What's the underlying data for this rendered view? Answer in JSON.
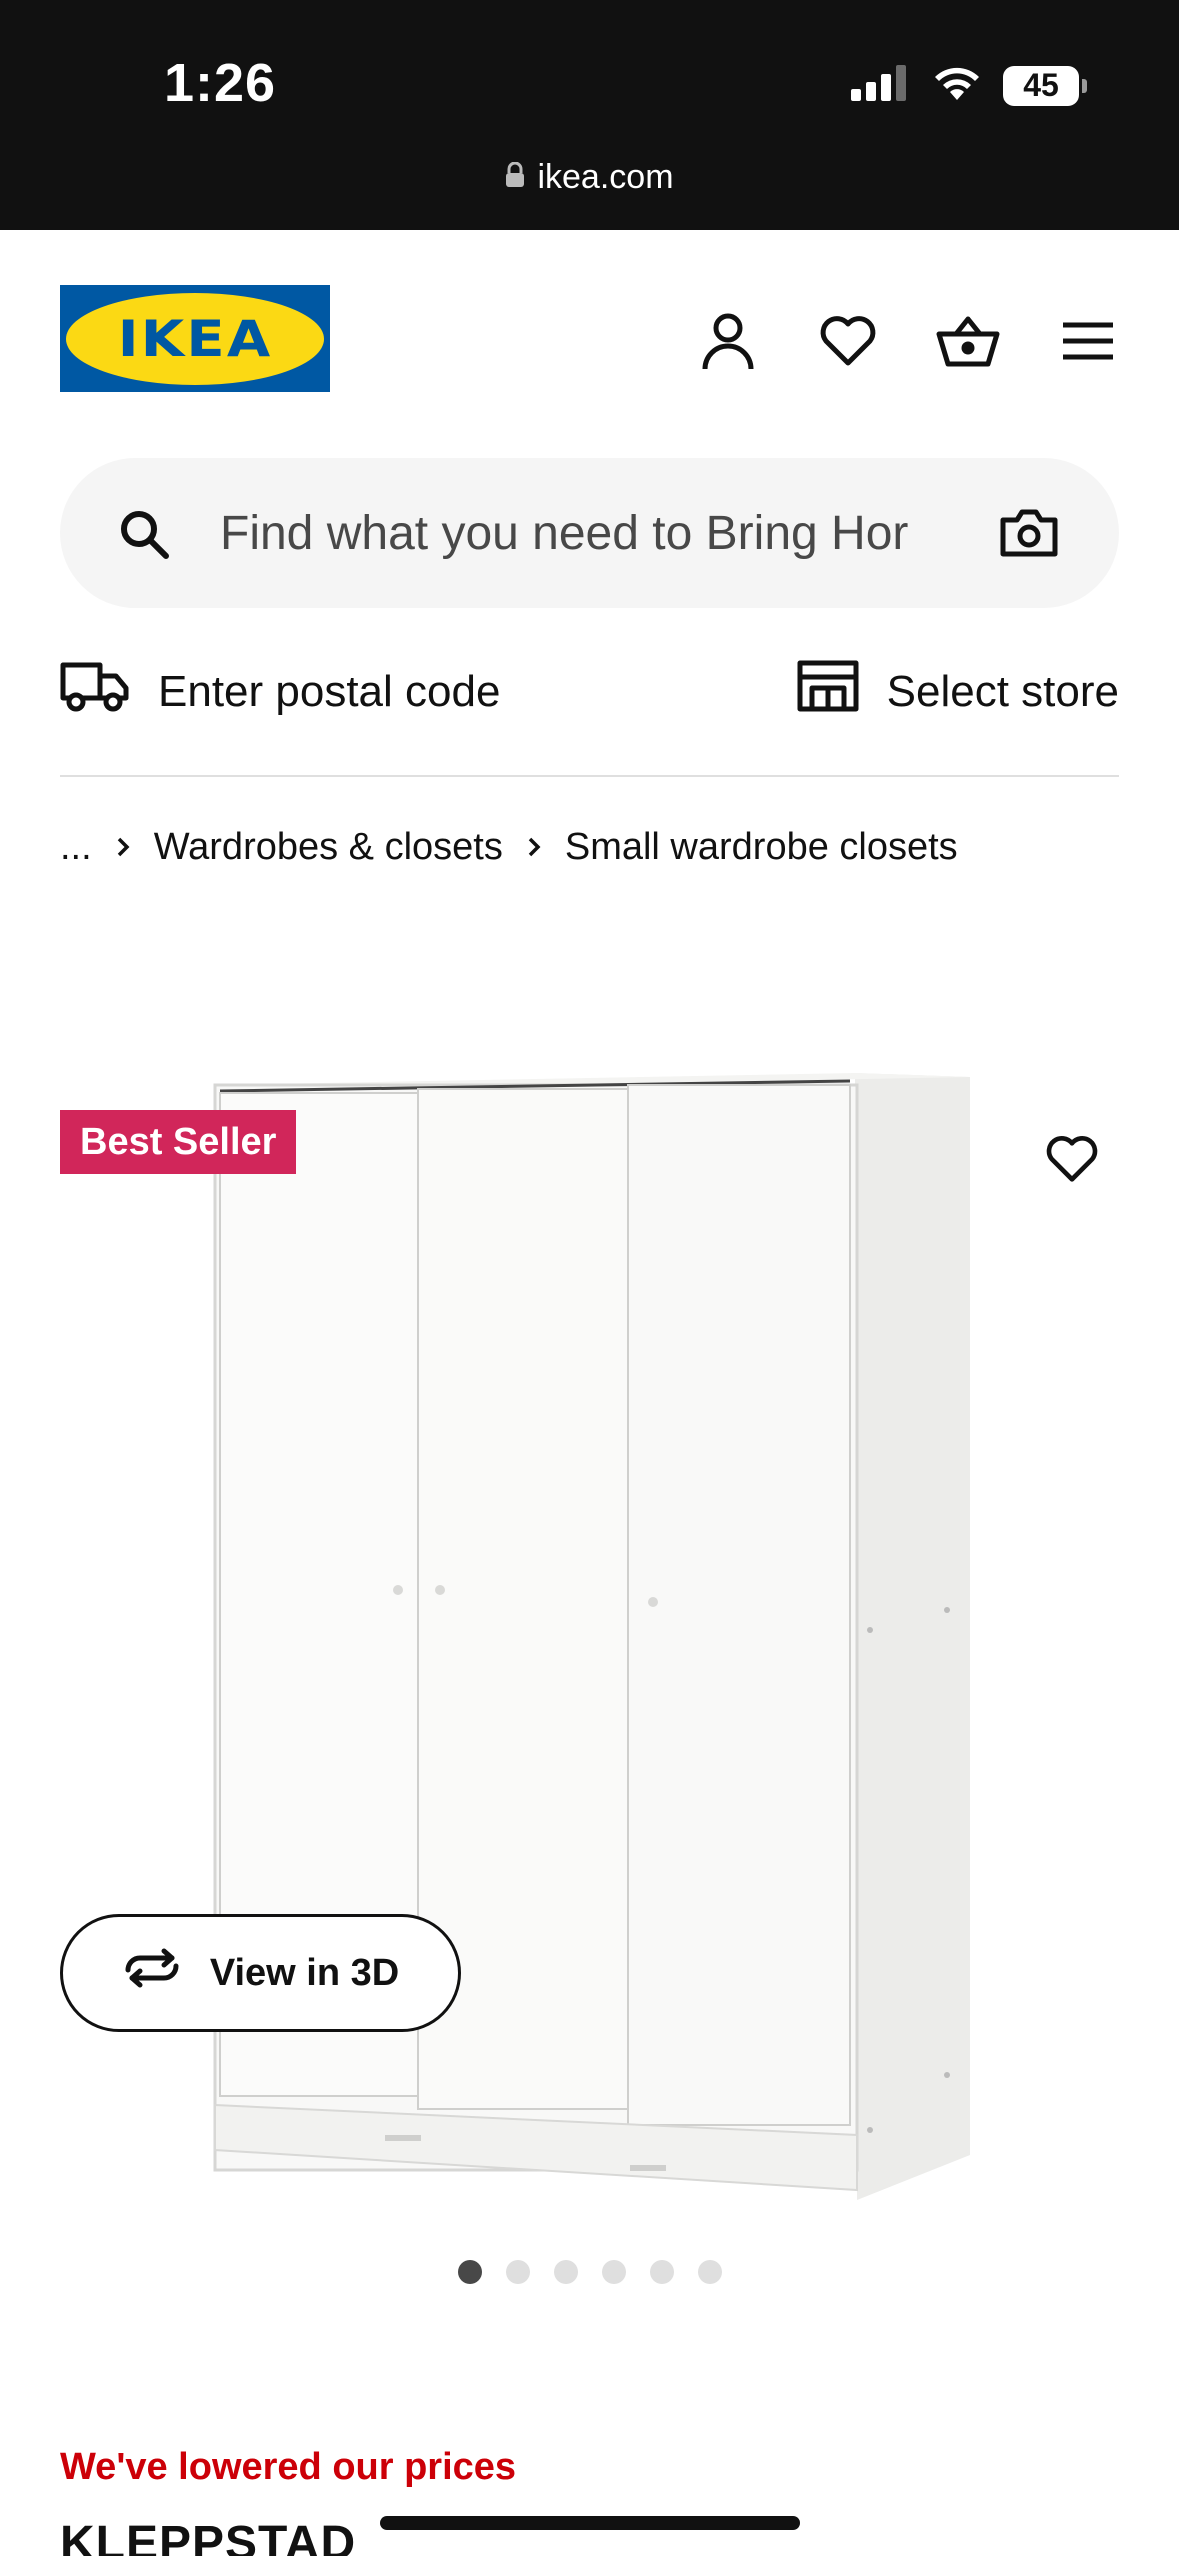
{
  "status_bar": {
    "time": "1:26",
    "battery": "45",
    "url": "ikea.com"
  },
  "header": {
    "logo_text": "IKEA",
    "icons": [
      "account-icon",
      "heart-icon",
      "basket-icon",
      "menu-icon"
    ]
  },
  "search": {
    "placeholder": "Find what you need to Bring Hor"
  },
  "delivery": {
    "postal_label": "Enter postal code",
    "store_label": "Select store"
  },
  "breadcrumb": {
    "ellipsis": "...",
    "items": [
      "Wardrobes & closets",
      "Small wardrobe closets"
    ]
  },
  "product": {
    "badge": "Best Seller",
    "view_3d_label": "View in 3D",
    "image_count": 6,
    "active_image": 1,
    "promo": "We've lowered our prices",
    "name": "KLEPPSTAD"
  },
  "colors": {
    "ikea_blue": "#0058a3",
    "ikea_yellow": "#fbd914",
    "badge_red": "#d1265a",
    "promo_red": "#cc0008"
  }
}
